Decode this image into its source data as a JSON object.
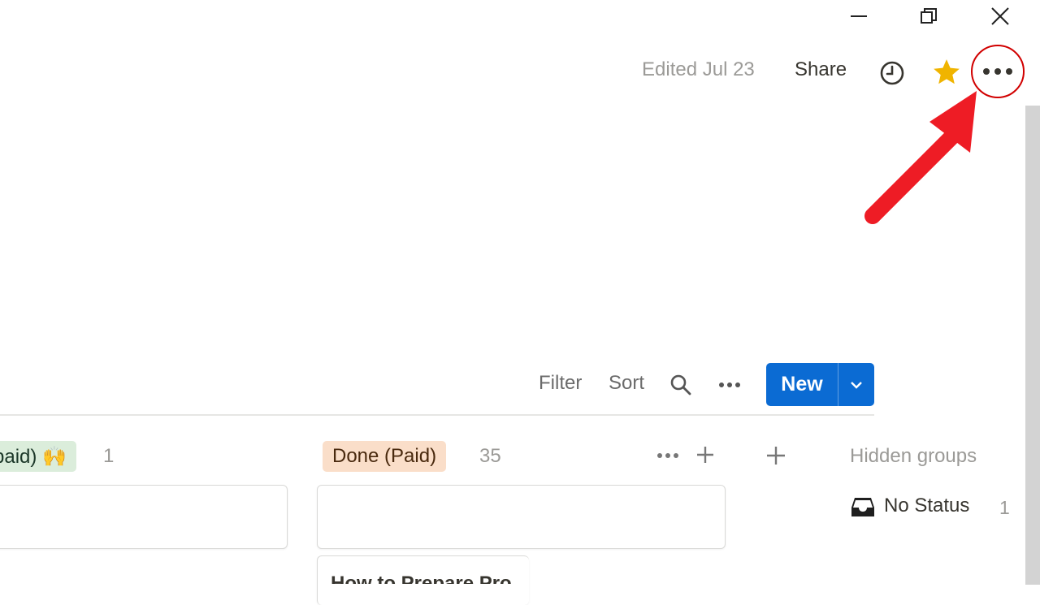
{
  "window_controls": {
    "minimize_icon": "minimize-icon",
    "restore_icon": "restore-icon",
    "close_icon": "close-icon"
  },
  "topbar": {
    "edited_text": "Edited Jul 23",
    "share_label": "Share",
    "history_icon": "clock-icon",
    "favorite_icon": "star-icon",
    "favorite_color": "#f0b400",
    "more_icon": "more-horizontal-icon"
  },
  "annotation": {
    "arrow_color": "#ee1c25",
    "circle_color": "#d10000"
  },
  "toolbar": {
    "filter_label": "Filter",
    "sort_label": "Sort",
    "search_icon": "search-icon",
    "more_icon": "more-horizontal-icon",
    "new_label": "New",
    "new_color": "#0b6bd3",
    "dropdown_icon": "chevron-down-icon"
  },
  "board": {
    "groups": [
      {
        "label": "paid) 🙌",
        "count": "1",
        "color": "#dbeddb"
      },
      {
        "label": "Done (Paid)",
        "count": "35",
        "color": "#fadec9"
      }
    ],
    "partial_card_text": "How to Prepare Pro",
    "hidden_groups_label": "Hidden groups",
    "no_status_label": "No Status",
    "no_status_count": "1",
    "no_status_icon": "inbox-icon"
  }
}
